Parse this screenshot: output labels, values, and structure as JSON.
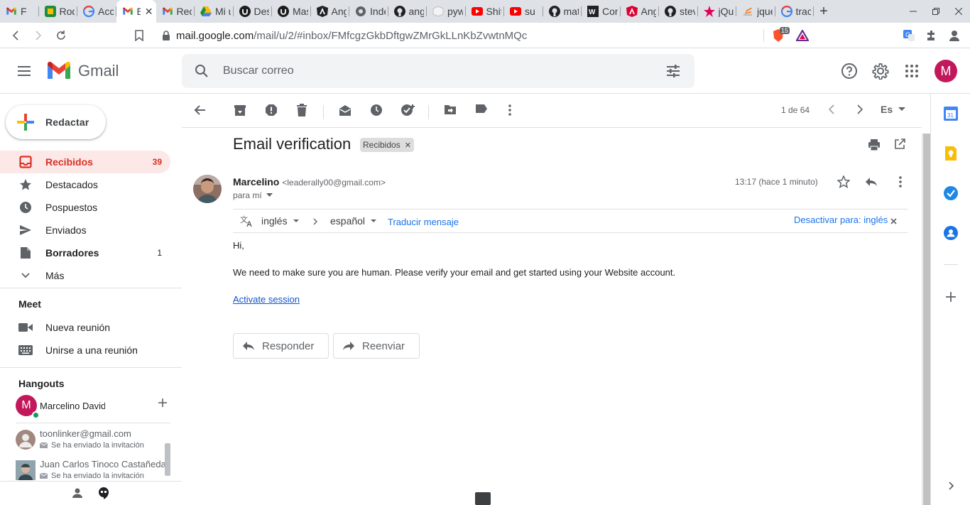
{
  "browser": {
    "tabs": [
      {
        "title": "F",
        "fav": "gmail"
      },
      {
        "title": "Roq",
        "fav": "green"
      },
      {
        "title": "Acc",
        "fav": "google"
      },
      {
        "title": "E",
        "fav": "gmail",
        "active": true
      },
      {
        "title": "Rec",
        "fav": "gmail"
      },
      {
        "title": "Mi u",
        "fav": "drive"
      },
      {
        "title": "Des",
        "fav": "udemy"
      },
      {
        "title": "Mas",
        "fav": "udemy"
      },
      {
        "title": "Ang",
        "fav": "angular-black"
      },
      {
        "title": "Inde",
        "fav": "globe"
      },
      {
        "title": "ang",
        "fav": "github"
      },
      {
        "title": "pyw",
        "fav": "cube"
      },
      {
        "title": "Shit",
        "fav": "youtube"
      },
      {
        "title": "su",
        "fav": "youtube"
      },
      {
        "title": "mat",
        "fav": "github"
      },
      {
        "title": "Con",
        "fav": "vue-dark"
      },
      {
        "title": "Ang",
        "fav": "angular"
      },
      {
        "title": "stev",
        "fav": "github"
      },
      {
        "title": "jQu",
        "fav": "star"
      },
      {
        "title": "jque",
        "fav": "stack"
      },
      {
        "title": "trac",
        "fav": "google"
      }
    ],
    "url_host": "mail.google.com",
    "url_path": "/mail/u/2/#inbox/FMfcgzGkbDftgwZMrGkLLnKbZvwtnMQc",
    "brave_badge": "15"
  },
  "header": {
    "app_name": "Gmail",
    "search_placeholder": "Buscar correo",
    "avatar_letter": "M"
  },
  "sidebar": {
    "compose_label": "Redactar",
    "items": [
      {
        "label": "Recibidos",
        "count": "39",
        "icon": "inbox-icon",
        "active": true
      },
      {
        "label": "Destacados",
        "count": "",
        "icon": "star-icon"
      },
      {
        "label": "Pospuestos",
        "count": "",
        "icon": "clock-icon"
      },
      {
        "label": "Enviados",
        "count": "",
        "icon": "send-icon"
      },
      {
        "label": "Borradores",
        "count": "1",
        "icon": "draft-icon",
        "bold": true
      },
      {
        "label": "Más",
        "count": "",
        "icon": "chevron-down-icon"
      }
    ],
    "meet_title": "Meet",
    "meet_items": [
      {
        "label": "Nueva reunión",
        "icon": "video-icon"
      },
      {
        "label": "Unirse a una reunión",
        "icon": "keyboard-icon"
      }
    ],
    "hangouts_title": "Hangouts",
    "hangouts_user": {
      "name": "Marcelino David",
      "letter": "M"
    },
    "contacts": [
      {
        "name": "toonlinker@gmail.com",
        "status": "Se ha enviado la invitación"
      },
      {
        "name": "Juan Carlos Tinoco Castañeda",
        "status": "Se ha enviado la invitación"
      }
    ]
  },
  "toolbar": {
    "pager": "1 de 64",
    "language": "Es"
  },
  "message": {
    "subject": "Email verification",
    "label": "Recibidos",
    "sender_name": "Marcelino",
    "sender_email": "<leaderally00@gmail.com>",
    "to": "para mí",
    "timestamp": "13:17 (hace 1 minuto)",
    "translate": {
      "from": "inglés",
      "to": "español",
      "action": "Traducir mensaje",
      "disable": "Desactivar para: inglés"
    },
    "greeting": "Hi,",
    "body": "We need to make sure you are human. Please verify your email and get started using your Website account.",
    "link": "Activate session",
    "reply_label": "Responder",
    "forward_label": "Reenviar"
  }
}
